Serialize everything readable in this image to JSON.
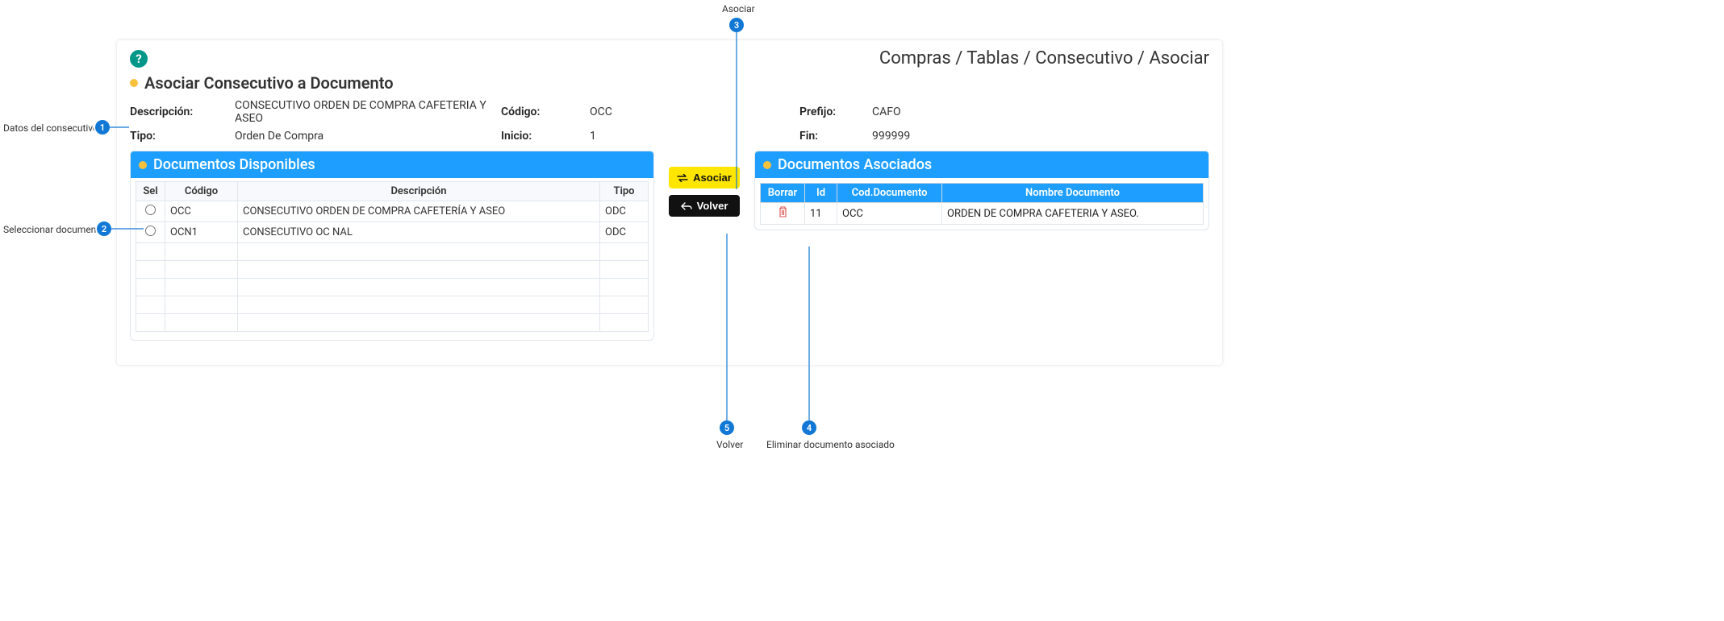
{
  "breadcrumb": "Compras / Tablas / Consecutivo / Asociar",
  "section_title": "Asociar Consecutivo a Documento",
  "info": {
    "descripcion_label": "Descripción:",
    "descripcion_value": "CONSECUTIVO ORDEN DE COMPRA CAFETERIA Y ASEO",
    "codigo_label": "Código:",
    "codigo_value": "OCC",
    "prefijo_label": "Prefijo:",
    "prefijo_value": "CAFO",
    "tipo_label": "Tipo:",
    "tipo_value": "Orden De Compra",
    "inicio_label": "Inicio:",
    "inicio_value": "1",
    "fin_label": "Fin:",
    "fin_value": "999999"
  },
  "disponibles": {
    "title": "Documentos Disponibles",
    "headers": {
      "sel": "Sel",
      "codigo": "Código",
      "descripcion": "Descripción",
      "tipo": "Tipo"
    },
    "rows": [
      {
        "codigo": "OCC",
        "descripcion": "CONSECUTIVO ORDEN DE COMPRA CAFETERÍA Y ASEO",
        "tipo": "ODC"
      },
      {
        "codigo": "OCN1",
        "descripcion": "CONSECUTIVO OC NAL",
        "tipo": "ODC"
      }
    ]
  },
  "buttons": {
    "asociar": "Asociar",
    "volver": "Volver"
  },
  "asociados": {
    "title": "Documentos Asociados",
    "headers": {
      "borrar": "Borrar",
      "id": "Id",
      "cod": "Cod.Documento",
      "nombre": "Nombre Documento"
    },
    "rows": [
      {
        "id": "11",
        "cod": "OCC",
        "nombre": "ORDEN DE COMPRA CAFETERIA Y ASEO."
      }
    ]
  },
  "annotations": {
    "a1": "Datos del consecutivo",
    "a2": "Seleccionar documento",
    "a3": "Asociar",
    "a4": "Eliminar documento asociado",
    "a5": "Volver",
    "n1": "1",
    "n2": "2",
    "n3": "3",
    "n4": "4",
    "n5": "5"
  }
}
